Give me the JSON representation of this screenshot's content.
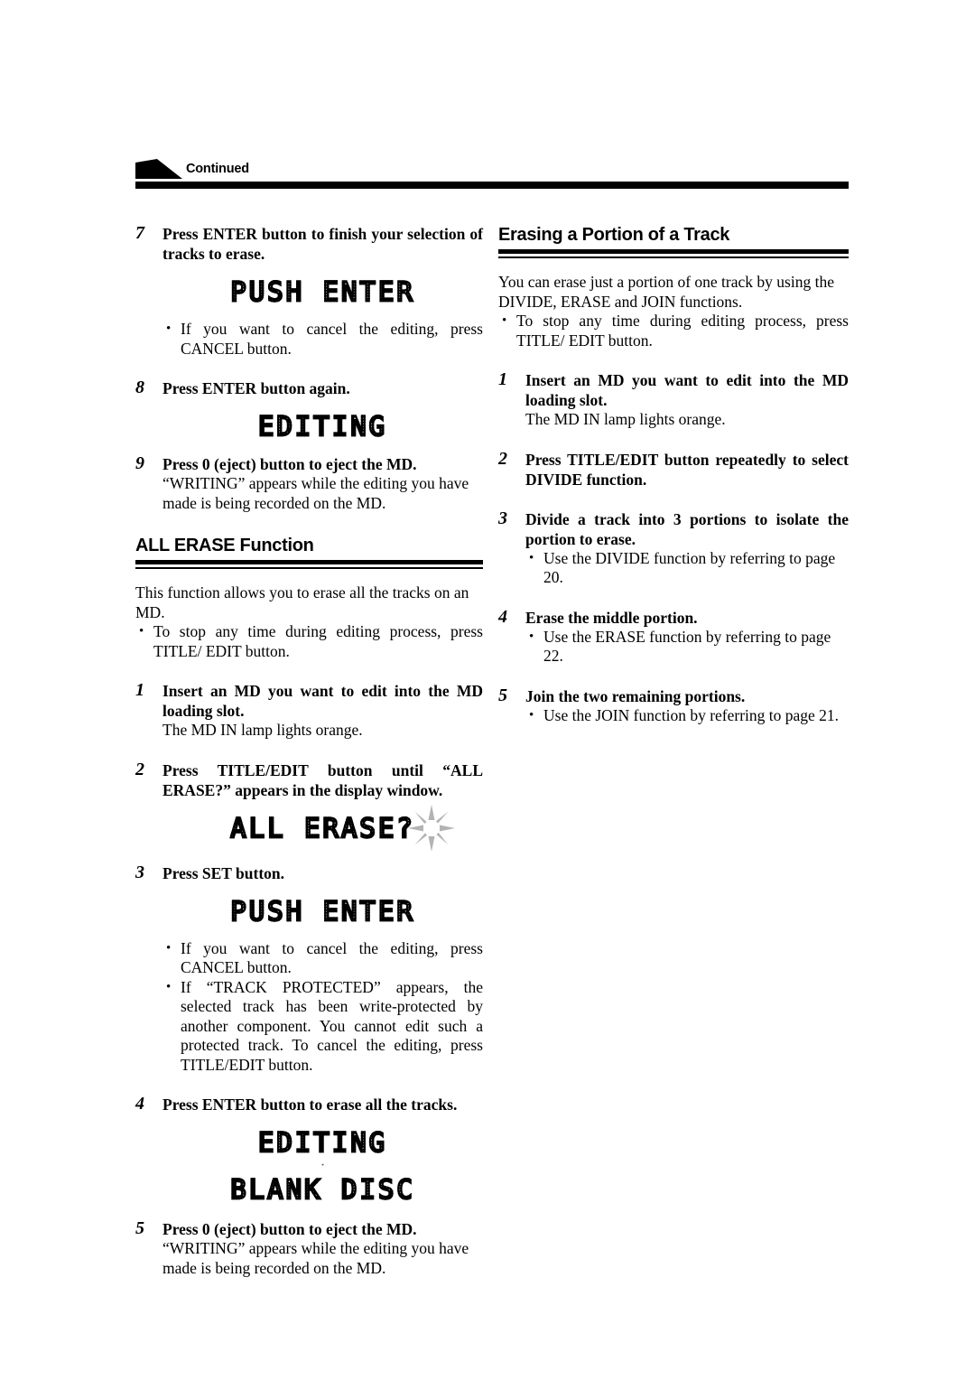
{
  "page": {
    "header": {
      "flag_icon": "continued-arrow-icon",
      "label": "Continued"
    }
  },
  "left_column": {
    "steps": [
      {
        "num": "7",
        "title": "Press ENTER button to finish your selection of tracks to erase.",
        "display": "PUSH ENTER",
        "bullets": [
          "If you want to cancel the editing, press CANCEL button."
        ]
      },
      {
        "num": "8",
        "title": "Press ENTER button again.",
        "display": "EDITING"
      },
      {
        "num": "9",
        "title": "Press 0  (eject) button to eject the MD.",
        "body": "“WRITING” appears while the editing you have made is being recorded on the MD."
      }
    ],
    "section": {
      "heading": "ALL ERASE Function",
      "intro": "This function allows you to erase all the tracks on an MD.",
      "intro_bullets": [
        "To stop any time during editing process, press TITLE/ EDIT button."
      ],
      "steps": [
        {
          "num": "1",
          "title": "Insert an MD you want to edit into the MD loading slot.",
          "body": "The MD IN lamp lights orange."
        },
        {
          "num": "2",
          "title": "Press TITLE/EDIT button until “ALL ERASE?” appears in the display window.",
          "display": "ALL ERASE?",
          "display_blinking": true
        },
        {
          "num": "3",
          "title": "Press SET button.",
          "display": "PUSH ENTER",
          "bullets": [
            "If you want to cancel the editing, press CANCEL button.",
            "If “TRACK PROTECTED” appears, the selected track has been write-protected by another component. You cannot edit such a protected track. To cancel the editing, press TITLE/EDIT button."
          ]
        },
        {
          "num": "4",
          "title": "Press ENTER button to erase all the tracks.",
          "display": "EDITING",
          "display2": "BLANK DISC",
          "display_separator": "·"
        },
        {
          "num": "5",
          "title": "Press 0  (eject) button to eject the MD.",
          "body": "“WRITING” appears while the editing you have made is being recorded on the MD."
        }
      ]
    }
  },
  "right_column": {
    "section": {
      "heading": "Erasing a Portion of a Track",
      "intro": "You can erase just a portion of one track by using the DIVIDE, ERASE and JOIN functions.",
      "intro_bullets": [
        "To stop any time during editing process, press TITLE/ EDIT button."
      ],
      "steps": [
        {
          "num": "1",
          "title": "Insert an MD you want to edit into the MD loading slot.",
          "body": "The MD IN lamp lights orange."
        },
        {
          "num": "2",
          "title": "Press TITLE/EDIT button repeatedly to select DIVIDE function."
        },
        {
          "num": "3",
          "title": "Divide a track into 3 portions to isolate the portion to erase.",
          "bullets": [
            "Use the DIVIDE function by referring to page 20."
          ]
        },
        {
          "num": "4",
          "title": "Erase the middle portion.",
          "bullets": [
            "Use the ERASE function by referring to page 22."
          ]
        },
        {
          "num": "5",
          "title": "Join the two remaining portions.",
          "bullets": [
            "Use the JOIN function by referring to page 21."
          ]
        }
      ]
    }
  },
  "colors": {
    "ink": "#000000",
    "paper": "#ffffff",
    "lcd_dot": "#555555",
    "burst": "#b3b3b3"
  }
}
